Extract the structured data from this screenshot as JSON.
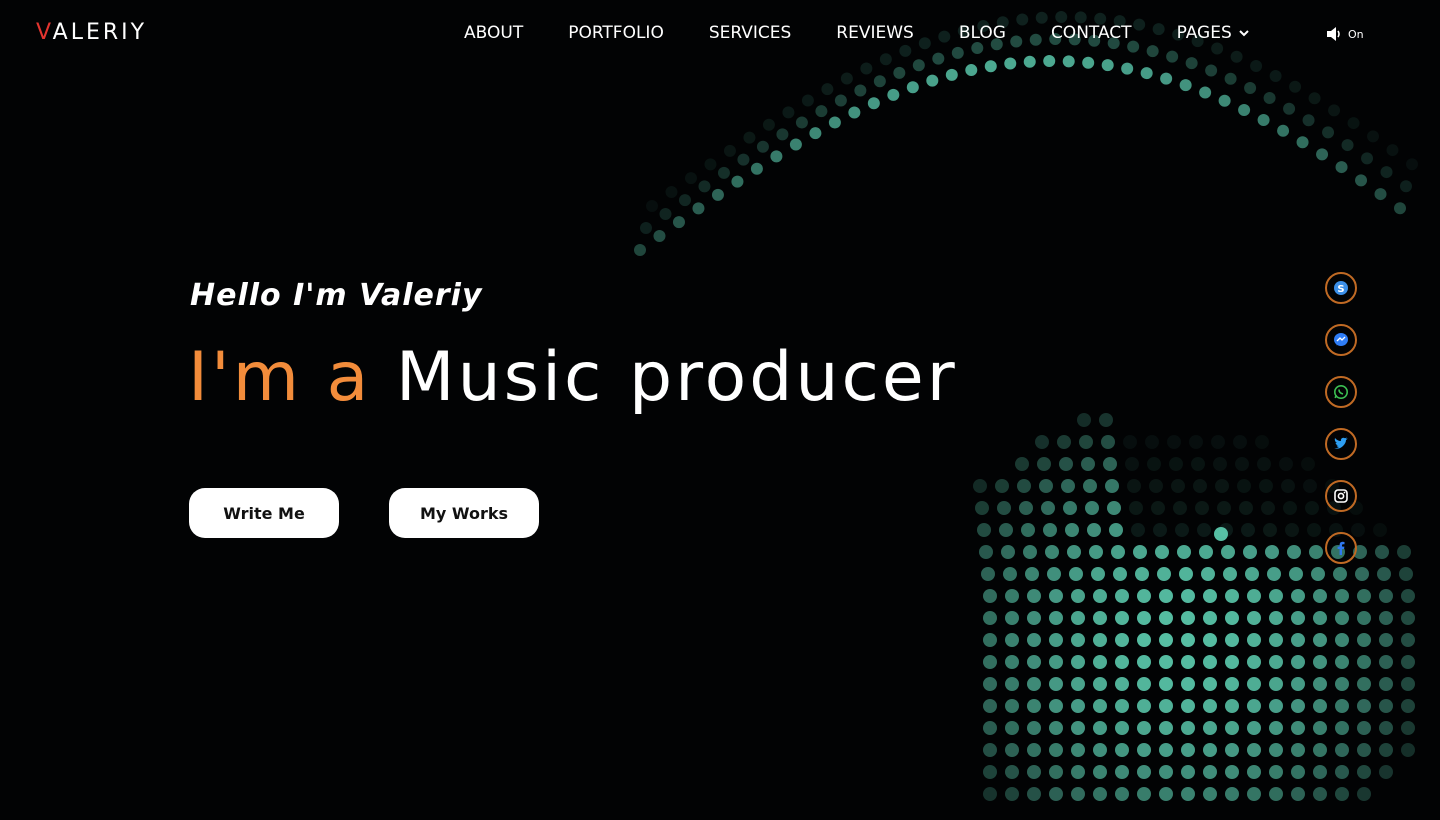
{
  "header": {
    "logo_first": "V",
    "logo_rest": "ALERIY",
    "nav": [
      {
        "label": "ABOUT"
      },
      {
        "label": "PORTFOLIO"
      },
      {
        "label": "SERVICES"
      },
      {
        "label": "REVIEWS"
      },
      {
        "label": "BLOG"
      },
      {
        "label": "CONTACT"
      },
      {
        "label": "PAGES"
      }
    ],
    "sound_label": "On"
  },
  "hero": {
    "greeting": "Hello I'm Valeriy",
    "prefix": "I'm a",
    "role": "Music producer",
    "write_button": "Write Me",
    "works_button": "My Works"
  },
  "social": [
    {
      "icon": "skype-icon",
      "color": "#3b8fe8"
    },
    {
      "icon": "messenger-icon",
      "color": "#2f7df6"
    },
    {
      "icon": "whatsapp-icon",
      "color": "#3cbf52"
    },
    {
      "icon": "twitter-icon",
      "color": "#2e9ef1"
    },
    {
      "icon": "instagram-icon",
      "color": "#ffffff"
    },
    {
      "icon": "facebook-icon",
      "color": "#2f78f0"
    }
  ],
  "colors": {
    "accent": "#f28c3b",
    "logo_accent": "#e3342f",
    "dots": "#5fd3b5",
    "social_border": "#c06a24"
  }
}
